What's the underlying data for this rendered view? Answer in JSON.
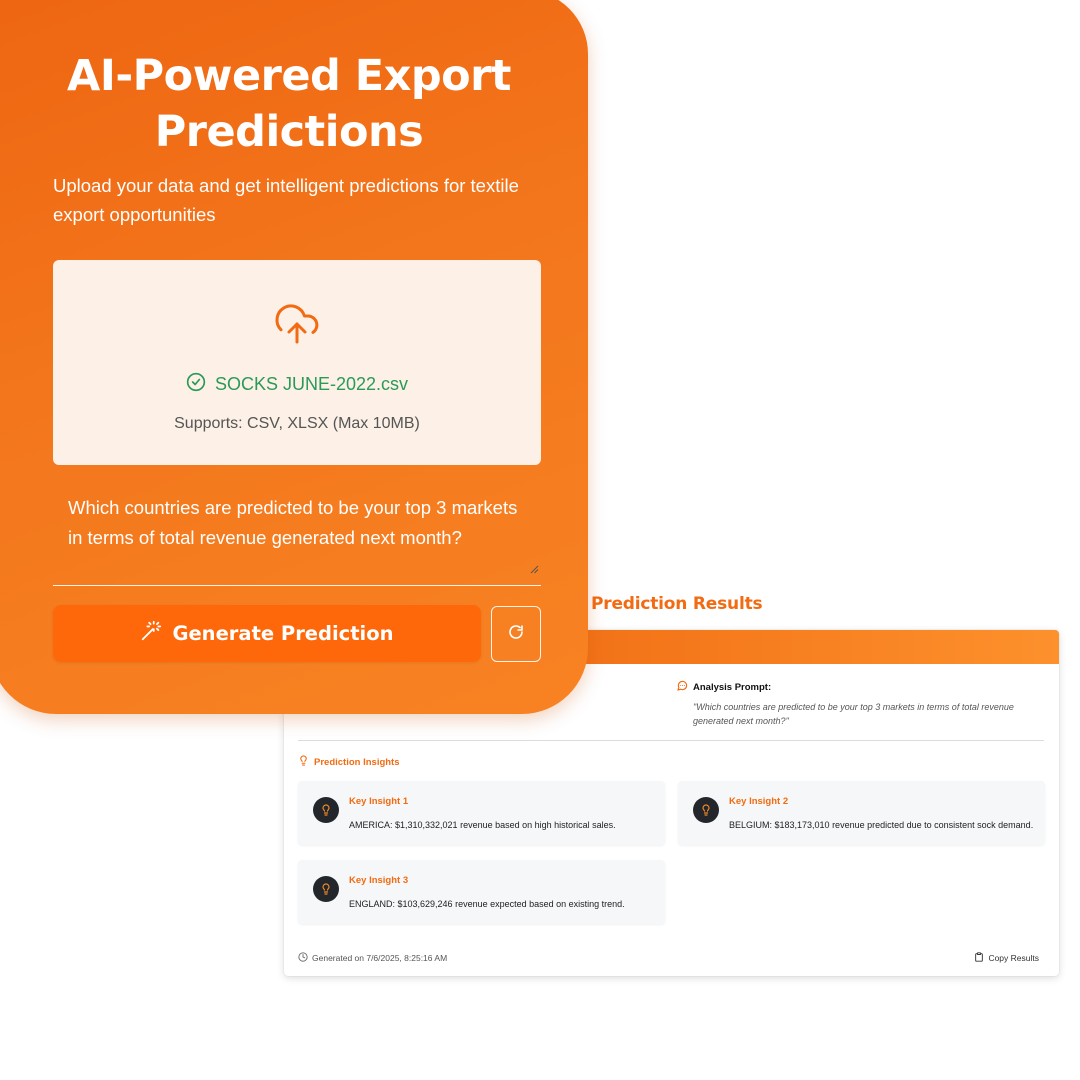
{
  "upload_panel": {
    "title": "AI-Powered Export Predictions",
    "subtitle": "Upload your data and get intelligent predictions for textile export opportunities",
    "upload_icon": "cloud-upload-icon",
    "file": {
      "status_icon": "check-circle-icon",
      "name": "SOCKS JUNE-2022.csv"
    },
    "supports_text": "Supports: CSV, XLSX (Max 10MB)",
    "question_value": "Which countries are predicted to be your top 3 markets in terms of total revenue generated next month?",
    "generate_button": {
      "icon": "magic-wand-icon",
      "label": "Generate Prediction"
    },
    "reset_button": {
      "icon": "refresh-icon"
    }
  },
  "results": {
    "title": "Prediction Results",
    "prompt_label": "Analysis Prompt:",
    "prompt_text": "\"Which countries are predicted to be your top 3 markets in terms of total revenue generated next month?\"",
    "insights_label": "Prediction Insights",
    "insights": [
      {
        "title": "Key Insight 1",
        "text": "AMERICA: $1,310,332,021 revenue based on high historical sales."
      },
      {
        "title": "Key Insight 2",
        "text": "BELGIUM: $183,173,010 revenue predicted due to consistent sock demand."
      },
      {
        "title": "Key Insight 3",
        "text": "ENGLAND: $103,629,246 revenue expected based on existing trend."
      }
    ],
    "generated_text": "Generated on 7/6/2025, 8:25:16 AM",
    "copy_label": "Copy Results"
  },
  "colors": {
    "brand_orange": "#f26b12",
    "button_orange": "#ff680a",
    "success_green": "#2a9a57",
    "dropzone_bg": "#fcf0e7",
    "insight_bg": "#f6f7f8",
    "bulb_bg": "#23262b"
  }
}
